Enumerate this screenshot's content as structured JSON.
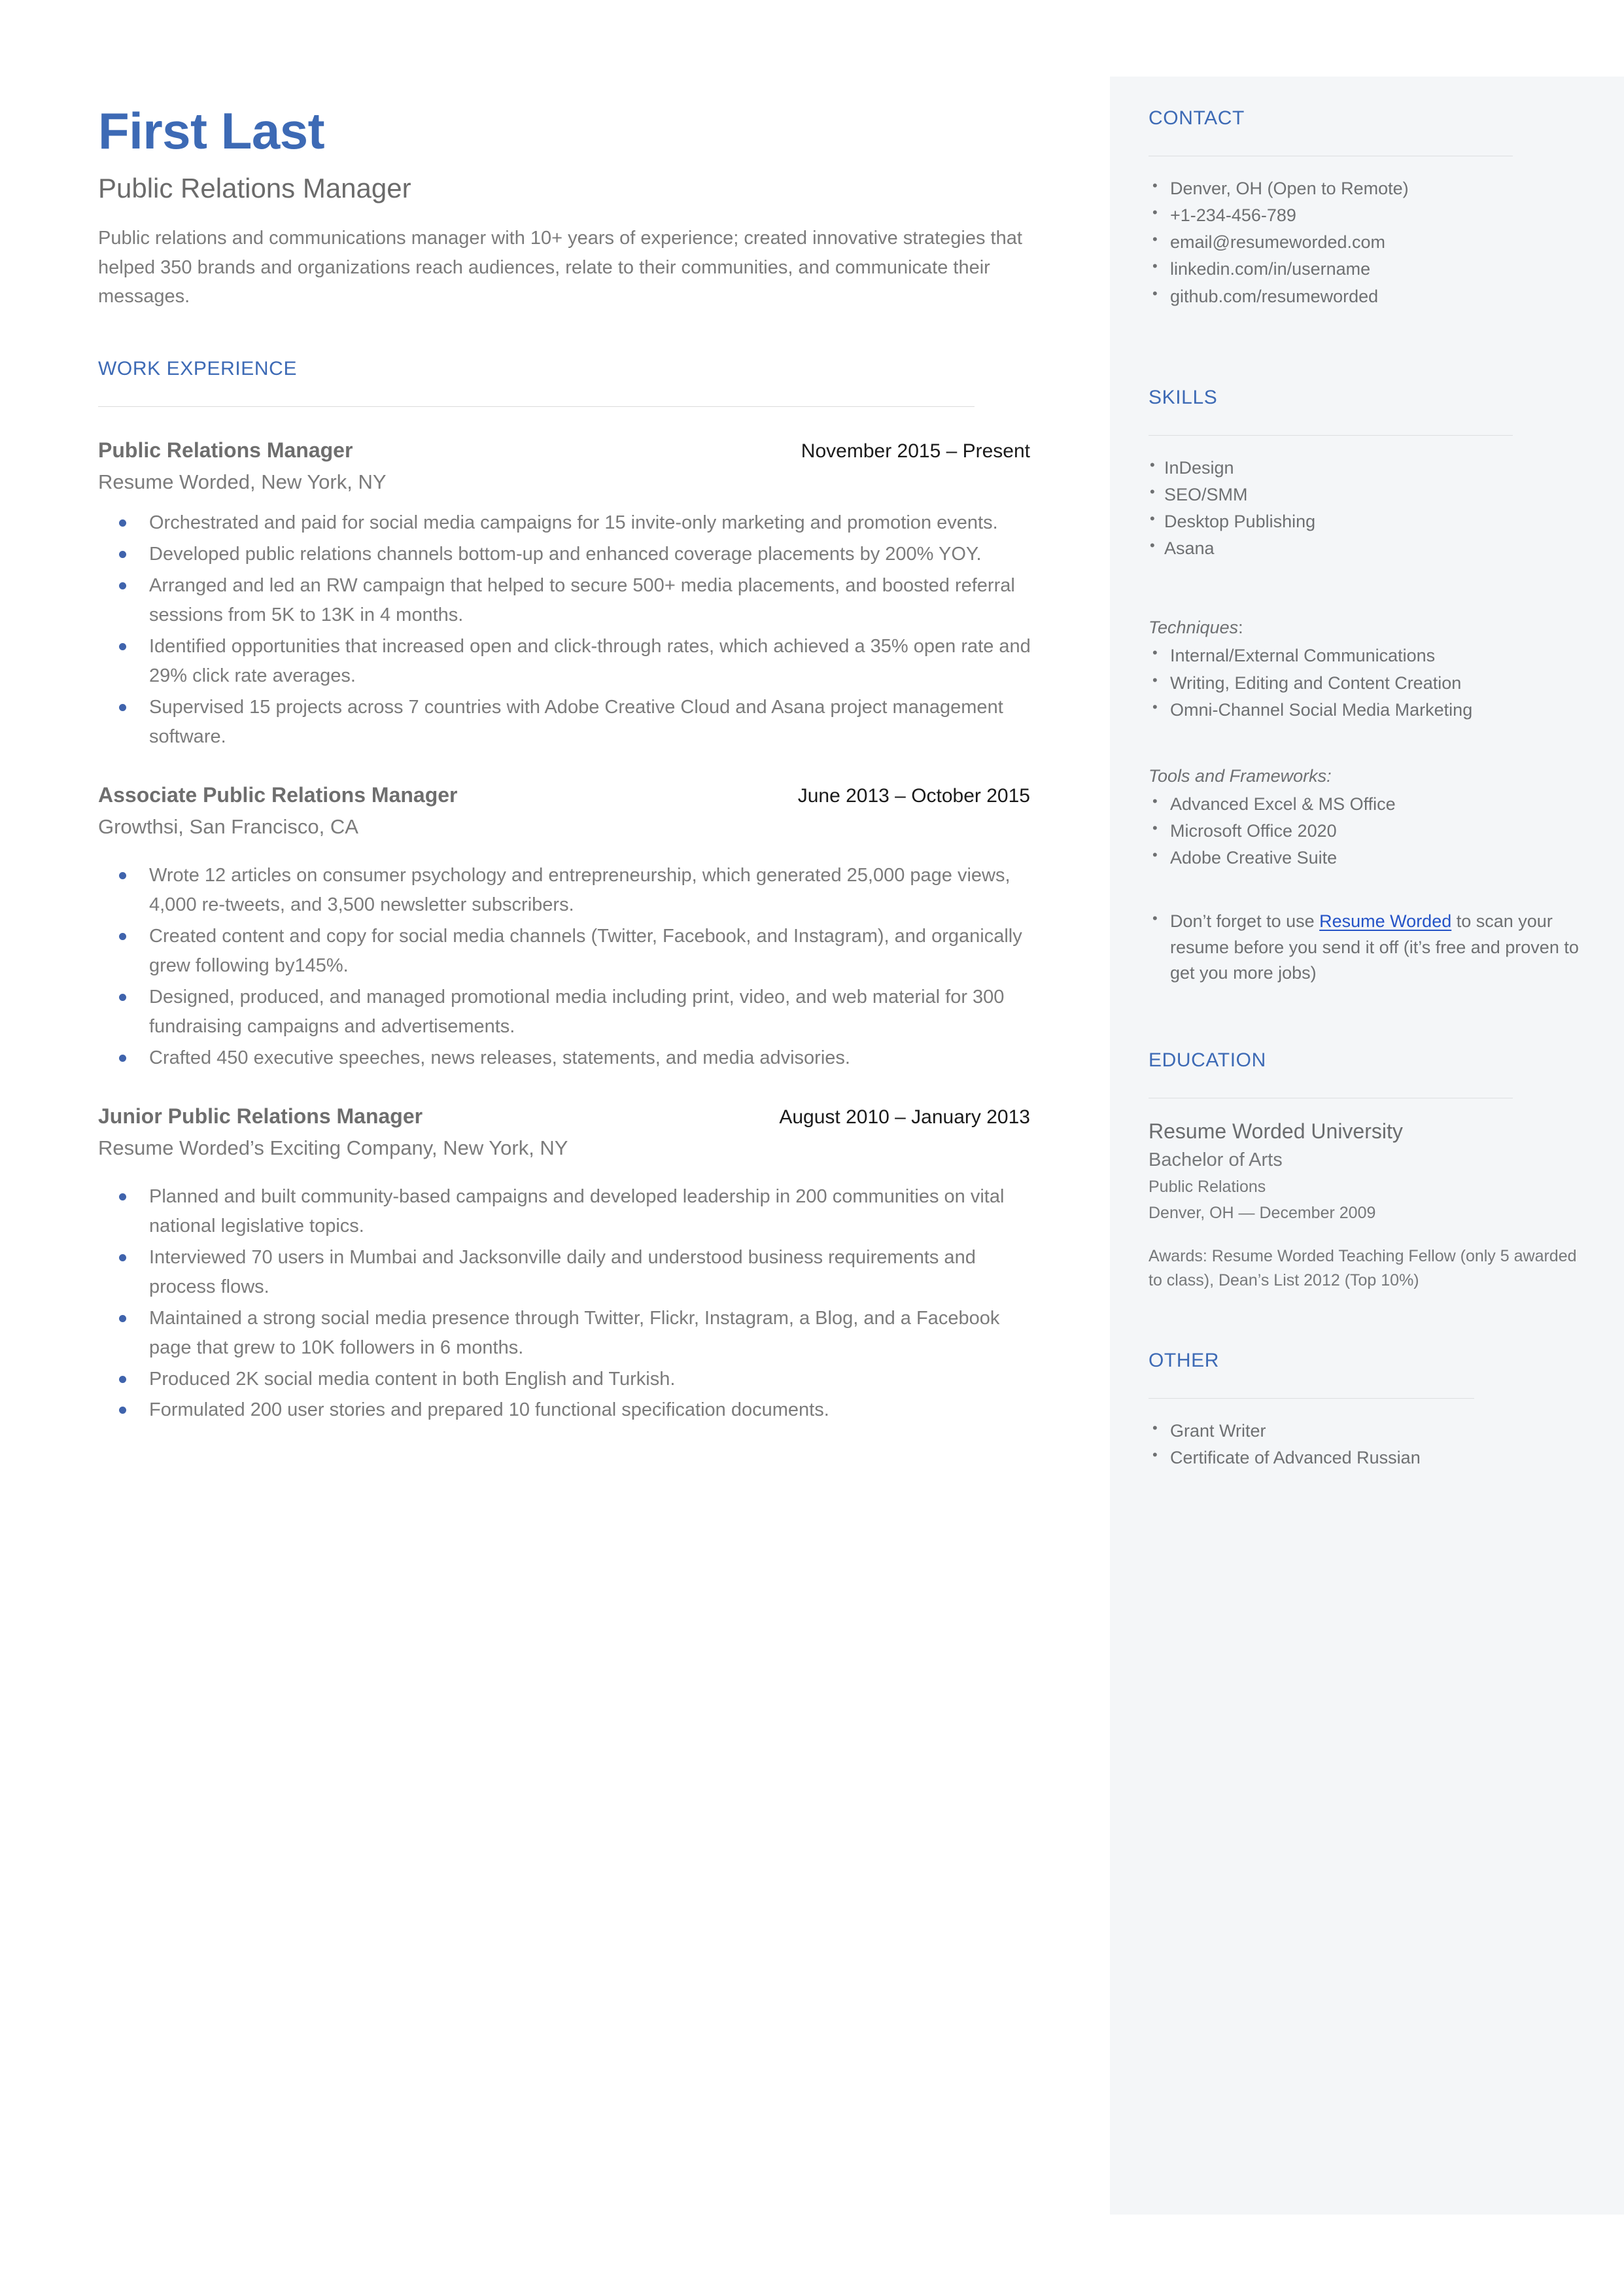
{
  "theme": {
    "accent_blue": "#3d6ab5",
    "link_blue": "#2453c7",
    "bullet_blue": "#3f63ac",
    "sidebar_bg": "#f4f6f8",
    "body_gray": "#7b7b7b"
  },
  "header": {
    "name": "First Last",
    "title": "Public Relations Manager",
    "summary": "Public relations and communications manager with 10+ years of experience; created innovative strategies that helped 350 brands and organizations reach audiences, relate to their communities, and communicate their messages."
  },
  "work_experience": {
    "heading": "WORK EXPERIENCE",
    "jobs": [
      {
        "role": "Public Relations Manager",
        "dates": "November 2015 – Present",
        "company": "Resume Worded, New York, NY",
        "bullets": [
          "Orchestrated and paid for social media campaigns for 15 invite-only marketing and promotion events.",
          "Developed public relations channels bottom-up and enhanced coverage placements by 200% YOY.",
          "Arranged and led an RW campaign that helped to secure 500+ media placements, and boosted referral sessions from 5K to 13K in 4 months.",
          "Identified opportunities that increased open and click-through rates, which achieved a 35% open rate and 29% click rate averages.",
          "Supervised 15 projects across 7 countries with Adobe Creative Cloud and Asana project management software."
        ]
      },
      {
        "role": "Associate Public Relations Manager",
        "dates": "June 2013 – October 2015",
        "company": "Growthsi, San Francisco, CA",
        "bullets": [
          "Wrote 12 articles on consumer psychology and entrepreneurship, which generated 25,000 page views, 4,000 re-tweets, and 3,500 newsletter subscribers.",
          "Created content and copy for social media channels (Twitter, Facebook, and Instagram), and organically grew following by145%.",
          "Designed, produced, and managed promotional media including print, video, and web material for 300 fundraising campaigns and advertisements.",
          "Crafted 450 executive speeches, news releases, statements, and media advisories."
        ]
      },
      {
        "role": "Junior Public Relations Manager",
        "dates": "August 2010 – January 2013",
        "company": "Resume Worded’s Exciting Company, New York, NY",
        "bullets": [
          "Planned and built community-based campaigns and developed leadership in 200 communities on vital national legislative topics.",
          "Interviewed 70 users in Mumbai and Jacksonville daily and understood business requirements and process flows.",
          "Maintained a strong social media presence through Twitter, Flickr, Instagram, a Blog, and a Facebook page that grew to 10K followers in 6 months.",
          "Produced 2K social media content in both English and Turkish.",
          "Formulated 200 user stories and prepared 10 functional specification documents."
        ]
      }
    ]
  },
  "contact": {
    "heading": "CONTACT",
    "items": [
      " Denver, OH (Open to Remote)",
      "+1-234-456-789",
      "email@resumeworded.com",
      "linkedin.com/in/username",
      "github.com/resumeworded"
    ]
  },
  "skills": {
    "heading": "SKILLS",
    "items": [
      "InDesign",
      "SEO/SMM",
      "Desktop Publishing",
      "Asana"
    ],
    "techniques": {
      "label": "Techniques",
      "colon": ":",
      "items": [
        " Internal/External Communications",
        " Writing, Editing and Content Creation",
        " Omni-Channel Social Media Marketing"
      ]
    },
    "tools": {
      "label": "Tools and Frameworks:",
      "items": [
        " Advanced Excel & MS Office",
        " Microsoft Office 2020",
        " Adobe Creative Suite"
      ]
    },
    "note": {
      "prefix": " Don’t forget to use ",
      "link_text": "Resume Worded",
      "suffix": " to scan your resume before you send it off (it’s free and proven to get you more jobs)"
    }
  },
  "education": {
    "heading": "EDUCATION",
    "school": "Resume Worded University",
    "degree": "Bachelor of Arts",
    "field": "Public Relations",
    "location_date": "Denver, OH — December 2009",
    "awards": "Awards: Resume Worded Teaching Fellow (only 5 awarded to class), Dean’s List 2012 (Top 10%)"
  },
  "other": {
    "heading": "OTHER",
    "items": [
      " Grant Writer",
      " Certificate of Advanced Russian"
    ]
  }
}
